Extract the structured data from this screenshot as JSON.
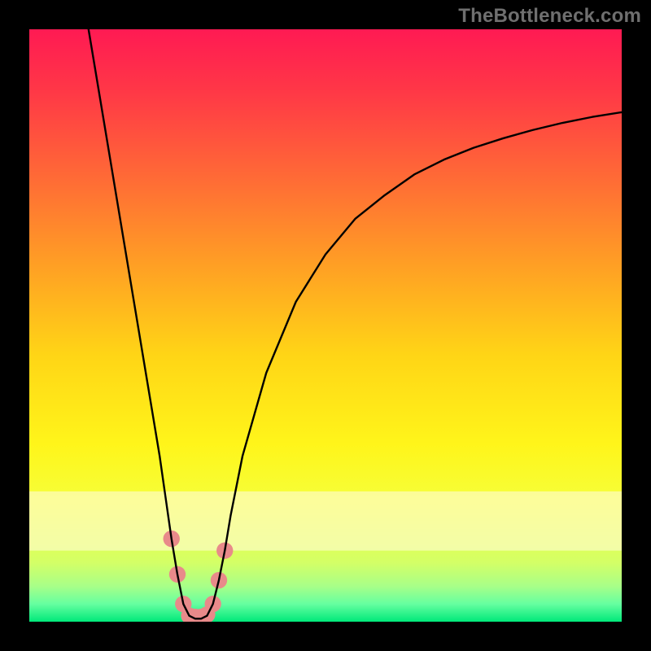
{
  "watermark": "TheBottleneck.com",
  "chart_data": {
    "type": "line",
    "title": "",
    "xlabel": "",
    "ylabel": "",
    "xlim": [
      0,
      100
    ],
    "ylim": [
      0,
      100
    ],
    "background_gradient": {
      "stops": [
        {
          "offset": 0.0,
          "color": "#ff1a53"
        },
        {
          "offset": 0.1,
          "color": "#ff3647"
        },
        {
          "offset": 0.25,
          "color": "#ff6a36"
        },
        {
          "offset": 0.4,
          "color": "#ffa024"
        },
        {
          "offset": 0.55,
          "color": "#ffd516"
        },
        {
          "offset": 0.7,
          "color": "#fff51a"
        },
        {
          "offset": 0.8,
          "color": "#f5ff3a"
        },
        {
          "offset": 0.9,
          "color": "#d4ff66"
        },
        {
          "offset": 0.94,
          "color": "#a8ff88"
        },
        {
          "offset": 0.97,
          "color": "#66ffa0"
        },
        {
          "offset": 1.0,
          "color": "#00e87a"
        }
      ],
      "tinted_band": {
        "y_start": 78,
        "y_end": 88,
        "color": "#fffccf"
      }
    },
    "series": [
      {
        "name": "bottleneck-curve",
        "color": "#000000",
        "x": [
          10.0,
          12.0,
          14.0,
          16.0,
          18.0,
          20.0,
          22.0,
          23.0,
          24.0,
          25.0,
          26.0,
          27.0,
          28.0,
          29.0,
          30.0,
          31.0,
          32.0,
          33.0,
          34.0,
          36.0,
          40.0,
          45.0,
          50.0,
          55.0,
          60.0,
          65.0,
          70.0,
          75.0,
          80.0,
          85.0,
          90.0,
          95.0,
          100.0
        ],
        "y": [
          100.0,
          88.0,
          76.0,
          64.0,
          52.0,
          40.0,
          28.0,
          21.0,
          14.0,
          8.0,
          3.0,
          1.0,
          0.5,
          0.5,
          1.0,
          3.0,
          7.0,
          12.0,
          18.0,
          28.0,
          42.0,
          54.0,
          62.0,
          68.0,
          72.0,
          75.5,
          78.0,
          80.0,
          81.6,
          83.0,
          84.2,
          85.2,
          86.0
        ]
      }
    ],
    "markers": {
      "name": "highlight-dots",
      "color": "#e88a8a",
      "radius_pct": 1.4,
      "points": [
        {
          "x": 24.0,
          "y": 14.0
        },
        {
          "x": 25.0,
          "y": 8.0
        },
        {
          "x": 26.0,
          "y": 3.0
        },
        {
          "x": 27.0,
          "y": 1.0
        },
        {
          "x": 28.0,
          "y": 0.8
        },
        {
          "x": 29.0,
          "y": 0.8
        },
        {
          "x": 30.0,
          "y": 1.2
        },
        {
          "x": 31.0,
          "y": 3.0
        },
        {
          "x": 32.0,
          "y": 7.0
        },
        {
          "x": 33.0,
          "y": 12.0
        }
      ]
    }
  }
}
